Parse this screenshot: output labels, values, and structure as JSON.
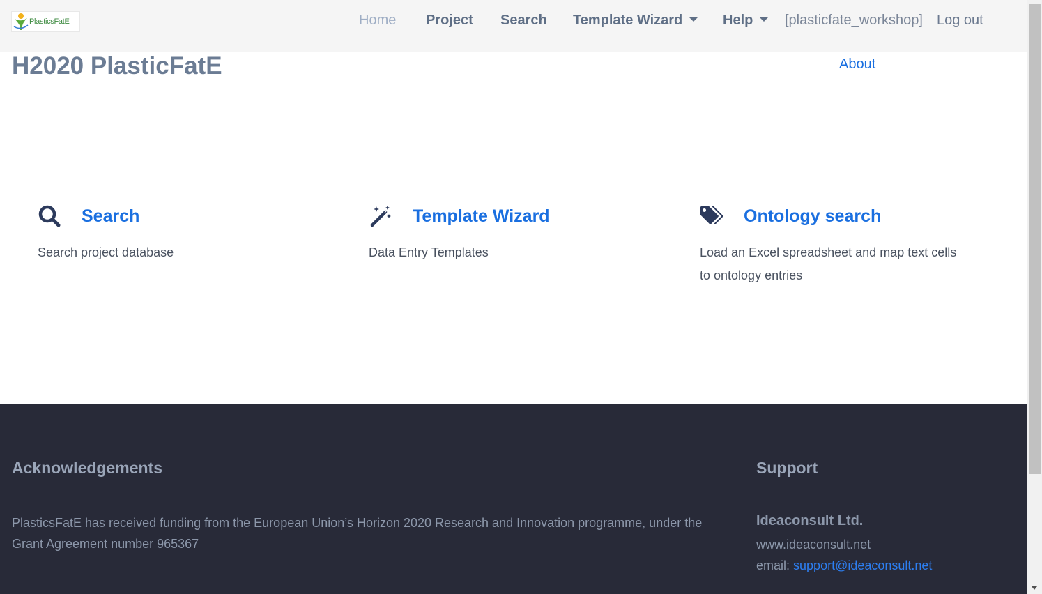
{
  "brand": {
    "logo_text": "PlasticsFatE"
  },
  "nav": {
    "home": "Home",
    "project": "Project",
    "search": "Search",
    "template_wizard": "Template Wizard",
    "help": "Help",
    "user": "[plasticfate_workshop]",
    "logout": "Log out"
  },
  "page": {
    "title": "H2020 PlasticFatE",
    "about": "About"
  },
  "cards": [
    {
      "title": "Search",
      "description": "Search project database",
      "icon": "search-icon"
    },
    {
      "title": "Template Wizard",
      "description": "Data Entry Templates",
      "icon": "magic-wand-icon"
    },
    {
      "title": "Ontology search",
      "description": "Load an Excel spreadsheet and map text cells to ontology entries",
      "icon": "tags-icon"
    }
  ],
  "footer": {
    "ack_title": "Acknowledgements",
    "ack_text": "PlasticsFatE has received funding from the European Union’s Horizon 2020 Research and Innovation programme, under the Grant Agreement number 965367",
    "support_title": "Support",
    "company": "Ideaconsult Ltd.",
    "website": "www.ideaconsult.net",
    "email_label": "email:",
    "email": "support@ideaconsult.net"
  },
  "colors": {
    "link": "#1a6fe0",
    "icon": "#2c3a5c",
    "footer_bg": "#282a38",
    "navbar_bg": "#f5f5f5"
  }
}
